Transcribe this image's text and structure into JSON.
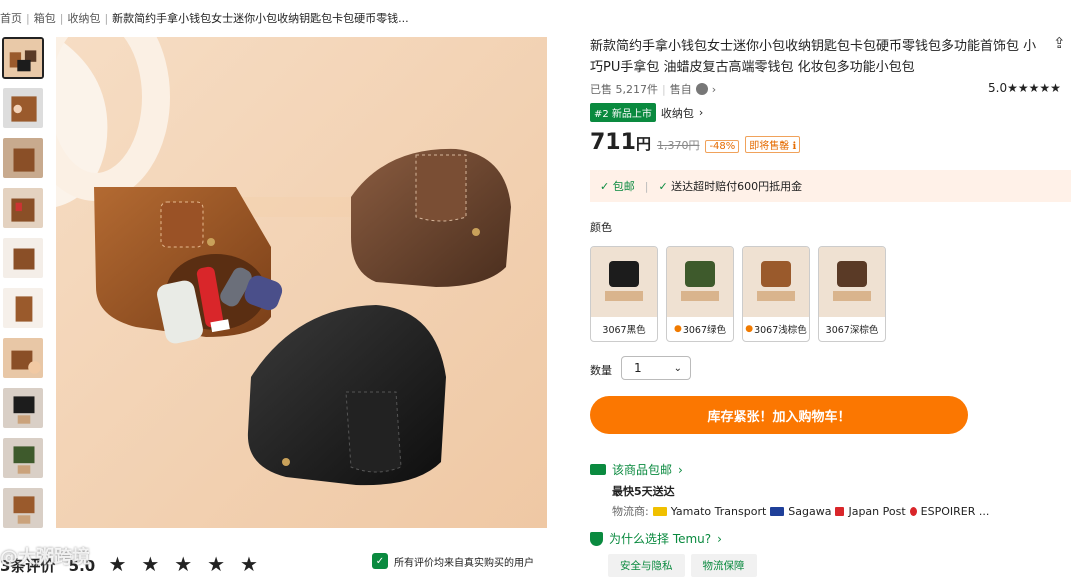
{
  "breadcrumb": [
    "首页",
    "箱包",
    "收纳包",
    "新款简约手拿小钱包女士迷你小包收纳钥匙包卡包硬币零钱..."
  ],
  "gallery": {
    "thumbnail_count": 10,
    "active_index": 0
  },
  "review_bar": {
    "label": "3条评价",
    "score": "5.0",
    "stars": "★ ★ ★ ★ ★",
    "verified_text": "所有评价均来自真实购买的用户"
  },
  "watermark": "@大粥跨境",
  "product": {
    "title": "新款简约手拿小钱包女士迷你小包收纳钥匙包卡包硬币零钱包多功能首饰包 小巧PU手拿包 油蜡皮复古高端零钱包 化妆包多功能小包包",
    "sold": "已售 5,217件",
    "seller_label": "售自",
    "rating_score": "5.0",
    "rating_stars": "★★★★★",
    "rank_badge": "#2 新品上市",
    "category_link": "收纳包",
    "price_main": "711",
    "price_unit": "円",
    "price_original": "1,370円",
    "discount": "-48%",
    "stock_tag": "即将售罄"
  },
  "shipping_banner": {
    "item1": "包邮",
    "item2": "送达超时赔付600円抵用金"
  },
  "color": {
    "label": "颜色",
    "options": [
      {
        "label": "3067黑色",
        "hot": false,
        "color": "#1c1c1c"
      },
      {
        "label": "3067绿色",
        "hot": true,
        "color": "#3e5a2c"
      },
      {
        "label": "3067浅棕色",
        "hot": true,
        "color": "#9a5a2c"
      },
      {
        "label": "3067深棕色",
        "hot": false,
        "color": "#5a3a26"
      }
    ]
  },
  "quantity": {
    "label": "数量",
    "value": "1"
  },
  "cta_label": "库存紧张！加入购物车！",
  "delivery": {
    "free_label": "该商品包邮",
    "eta": "最快5天送达",
    "carriers_label": "物流商:",
    "carriers": [
      "Yamato Transport",
      "Sagawa",
      "Japan Post",
      "ESPOIRER ..."
    ]
  },
  "why": {
    "label": "为什么选择 Temu?",
    "tabs": [
      "安全与隐私",
      "物流保障"
    ]
  },
  "colors": {
    "accent": "#fb7701",
    "green": "#0a8a3f",
    "bg_banner": "#fff1e8"
  }
}
